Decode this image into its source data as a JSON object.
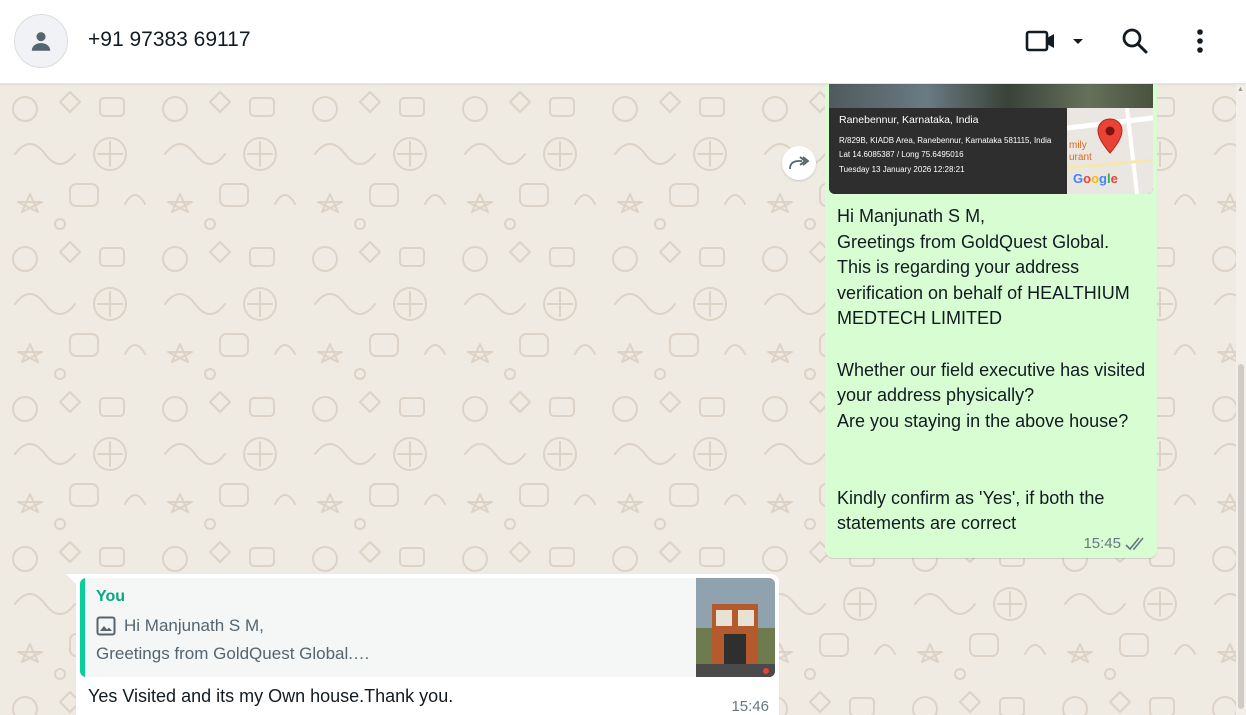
{
  "header": {
    "contact_name": "+91 97383 69117"
  },
  "outgoing_message": {
    "location_card": {
      "city": "Ranebennur, Karnataka, India",
      "address": "R/829B, KIADB Area, Ranebennur, Karnataka 581115, India",
      "lat_long": "Lat 14.6085387 / Long 75.6495016",
      "datetime": "Tuesday 13 January 2026 12:28:21",
      "map_place_label": "mily\nurant",
      "map_brand": "Google"
    },
    "text": "Hi Manjunath S M,\nGreetings from GoldQuest Global.\nThis is regarding your address verification on behalf of HEALTHIUM MEDTECH LIMITED\n\nWhether our field executive has visited your address physically?\nAre you staying in the above house?\n\n\nKindly confirm as 'Yes', if both the statements are correct",
    "time": "15:45",
    "status": "read"
  },
  "incoming_message": {
    "quote": {
      "author": "You",
      "line1": "Hi Manjunath S M,",
      "line2": "Greetings from GoldQuest Global.…"
    },
    "text": "Yes Visited and its my Own house.Thank you.",
    "time": "15:46"
  },
  "colors": {
    "outgoing_bubble": "#d9fdd3",
    "incoming_bubble": "#ffffff",
    "quote_accent": "#06cf9c",
    "chat_background": "#efeae2"
  }
}
